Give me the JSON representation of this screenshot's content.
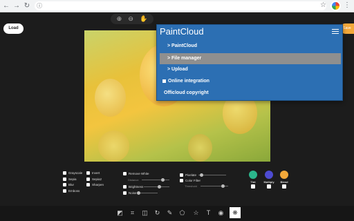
{
  "browser": {
    "back_icon": "←",
    "forward_icon": "→",
    "reload_icon": "↻",
    "info_icon": "ⓘ",
    "star_icon": "☆",
    "menu_icon": "⋮"
  },
  "app": {
    "load_label": "Load",
    "save_label": "Save",
    "zoom": {
      "zoom_in_icon": "⊕",
      "zoom_out_icon": "⊖",
      "pan_icon": "✋"
    }
  },
  "menu": {
    "title": "PaintCloud",
    "items": [
      {
        "label": "> PaintCloud"
      },
      {
        "label": "> File manager"
      },
      {
        "label": "> Upload"
      },
      {
        "label": "Online integration"
      },
      {
        "label": "Officloud copyright"
      }
    ]
  },
  "filters": {
    "col1": [
      "Grayscale",
      "Sepia",
      "Blur",
      "Emboss"
    ],
    "col2": [
      "Invert",
      "Sepia2",
      "Sharpen"
    ],
    "col3": {
      "remove_white": "Remove White",
      "distance": "Distance",
      "brightness": "Brightness",
      "noise": "Noise"
    },
    "col4": {
      "pixelate": "Pixelate",
      "color_filter": "Color Filter",
      "threshold": "Threshold"
    },
    "colors": [
      {
        "label": "Tint",
        "color": "#2bb58c"
      },
      {
        "label": "Multiply",
        "color": "#4d4bd1"
      },
      {
        "label": "Blend",
        "color": "#f2a83a"
      }
    ]
  },
  "toolbar": {
    "tools": [
      {
        "name": "shadow-icon",
        "glyph": "◩"
      },
      {
        "name": "crop-icon",
        "glyph": "⌗"
      },
      {
        "name": "flip-icon",
        "glyph": "◫"
      },
      {
        "name": "rotate-icon",
        "glyph": "↻"
      },
      {
        "name": "draw-icon",
        "glyph": "✎"
      },
      {
        "name": "shape-icon",
        "glyph": "⬠"
      },
      {
        "name": "star-icon",
        "glyph": "☆"
      },
      {
        "name": "text-icon",
        "glyph": "T"
      },
      {
        "name": "mask-icon",
        "glyph": "◉"
      },
      {
        "name": "filter-icon",
        "glyph": "❋"
      }
    ]
  }
}
